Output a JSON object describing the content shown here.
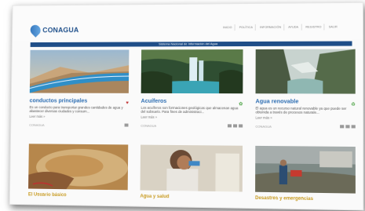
{
  "header": {
    "logo_text": "CONAGUA",
    "nav": [
      "INICIO",
      "POLÍTICA",
      "INFORMACIÓN",
      "AYUDA",
      "REGISTRO",
      "SALIR"
    ]
  },
  "banner": {
    "title": "Sistema Nacional de Información del Agua"
  },
  "cards": [
    {
      "title": "conductos principales",
      "text": "Es un conducto para transportar grandes cantidades de agua y abastecer diversas ciudades y consum...",
      "more": "Leer más »",
      "footer": "CONAGUA",
      "title_color": "#2f6fb3"
    },
    {
      "title": "Acuíferos",
      "text": "Los acuíferos son formaciones geológicas que almacenan agua del subsuelo. Para fines de administraci...",
      "more": "Leer más »",
      "footer": "CONAGUA",
      "title_color": "#2f6fb3"
    },
    {
      "title": "Agua renovable",
      "text": "El agua es un recurso natural renovable ya que puede ser obtenida a través de procesos naturale...",
      "more": "Leer más »",
      "footer": "CONAGUA",
      "title_color": "#2f6fb3"
    },
    {
      "title": "El Usuario básico",
      "text": "",
      "more": "",
      "footer": "",
      "title_color": "#c89b22"
    },
    {
      "title": "Agua y salud",
      "text": "",
      "more": "",
      "footer": "",
      "title_color": "#c89b22"
    },
    {
      "title": "Desastres y emergencias",
      "text": "",
      "more": "",
      "footer": "",
      "title_color": "#c89b22"
    }
  ]
}
